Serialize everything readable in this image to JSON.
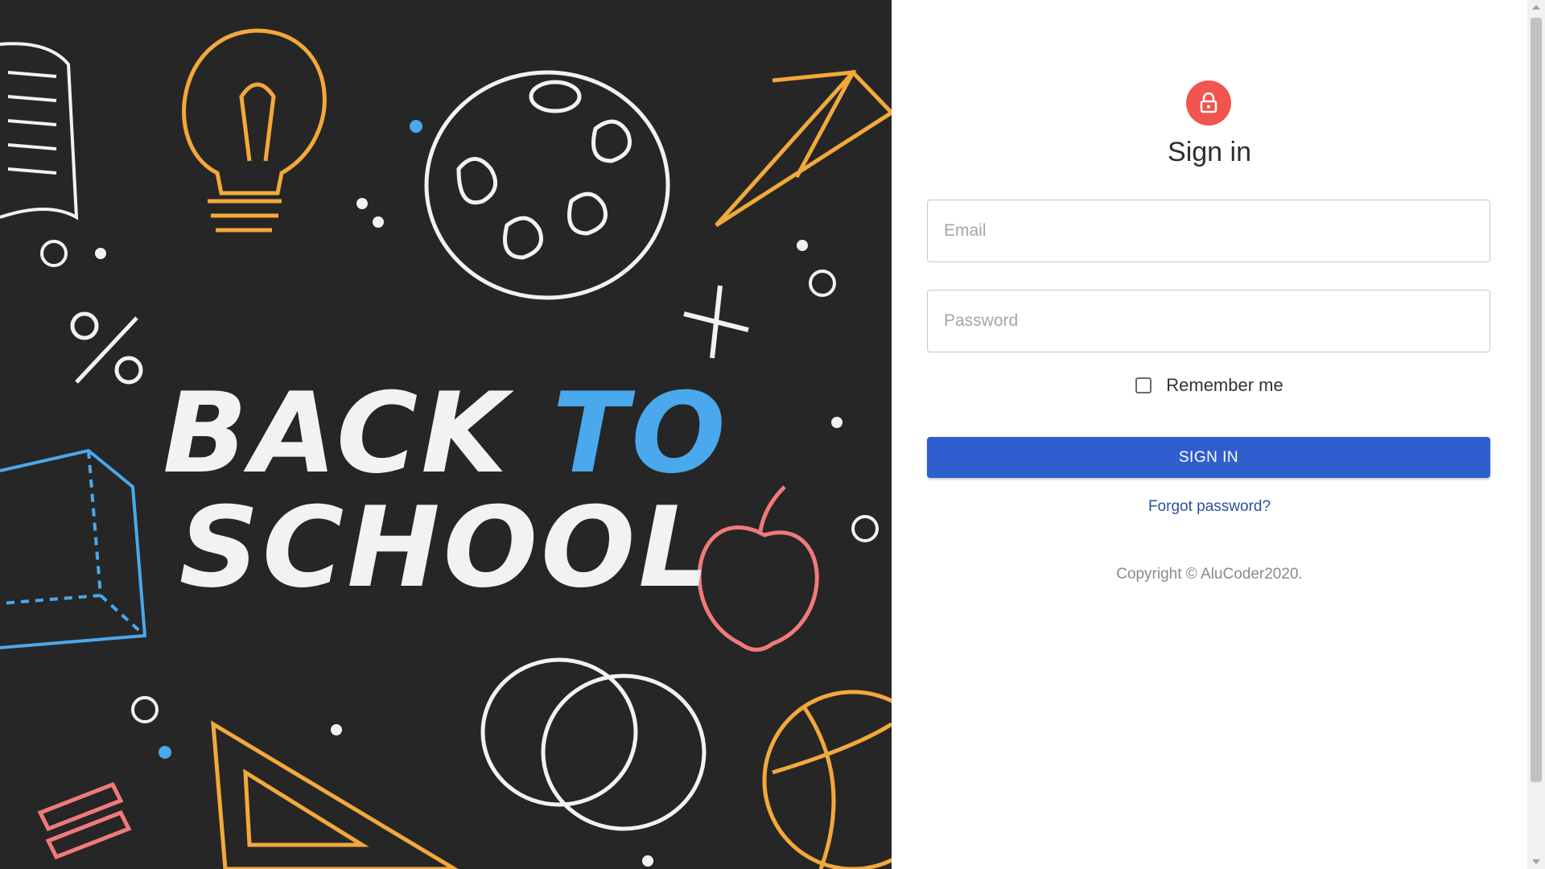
{
  "hero": {
    "line1_a": "BACK",
    "line1_b": "TO",
    "line2": "SCHOOL",
    "illustrations": [
      "book-icon",
      "lightbulb-icon",
      "palette-icon",
      "paper-plane-icon",
      "percent-icon",
      "plus-icon",
      "cube-icon",
      "apple-icon",
      "speech-bubbles-icon",
      "set-square-icon",
      "basketball-icon"
    ],
    "colors": {
      "background": "#262626",
      "chalk_white": "#f2f2f2",
      "chalk_blue": "#4aa8ec",
      "chalk_orange": "#f2a93b",
      "chalk_red": "#f07a7a"
    }
  },
  "signin": {
    "title": "Sign in",
    "email_placeholder": "Email",
    "password_placeholder": "Password",
    "remember_label": "Remember me",
    "remember_checked": false,
    "submit_label": "SIGN IN",
    "forgot_label": "Forgot password?",
    "copyright": "Copyright © AluCoder2020."
  },
  "colors": {
    "avatar": "#f0554e",
    "primary_button": "#2f5fcf",
    "link": "#2d4f9e"
  }
}
